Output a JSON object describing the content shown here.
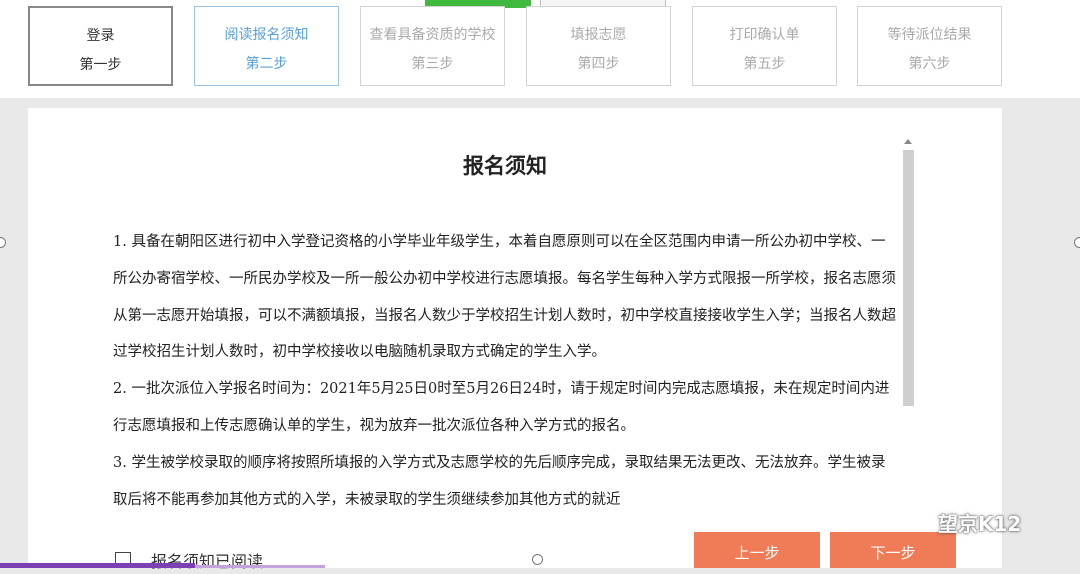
{
  "steps": [
    {
      "title": "登录",
      "sub": "第一步",
      "state": "done"
    },
    {
      "title": "阅读报名须知",
      "sub": "第二步",
      "state": "active"
    },
    {
      "title": "查看具备资质的学校",
      "sub": "第三步",
      "state": "pending"
    },
    {
      "title": "填报志愿",
      "sub": "第四步",
      "state": "pending"
    },
    {
      "title": "打印确认单",
      "sub": "第五步",
      "state": "pending"
    },
    {
      "title": "等待派位结果",
      "sub": "第六步",
      "state": "pending"
    }
  ],
  "notice": {
    "title": "报名须知",
    "paragraphs": [
      "1. 具备在朝阳区进行初中入学登记资格的小学毕业年级学生，本着自愿原则可以在全区范围内申请一所公办初中学校、一所公办寄宿学校、一所民办学校及一所一般公办初中学校进行志愿填报。每名学生每种入学方式限报一所学校，报名志愿须从第一志愿开始填报，可以不满额填报，当报名人数少于学校招生计划人数时，初中学校直接接收学生入学；当报名人数超过学校招生计划人数时，初中学校接收以电脑随机录取方式确定的学生入学。",
      "2. 一批次派位入学报名时间为：2021年5月25日0时至5月26日24时，请于规定时间内完成志愿填报，未在规定时间内进行志愿填报和上传志愿确认单的学生，视为放弃一批次派位各种入学方式的报名。",
      "3. 学生被学校录取的顺序将按照所填报的入学方式及志愿学校的先后顺序完成，录取结果无法更改、无法放弃。学生被录取后将不能再参加其他方式的入学，未被录取的学生须继续参加其他方式的就近"
    ]
  },
  "agree_label": "报名须知已阅读",
  "buttons": {
    "prev": "上一步",
    "next": "下一步"
  },
  "watermark": "望京K12",
  "scroll_position": 0.0,
  "colors": {
    "accent": "#ef7b57",
    "active_step": "#5aa0d8"
  }
}
